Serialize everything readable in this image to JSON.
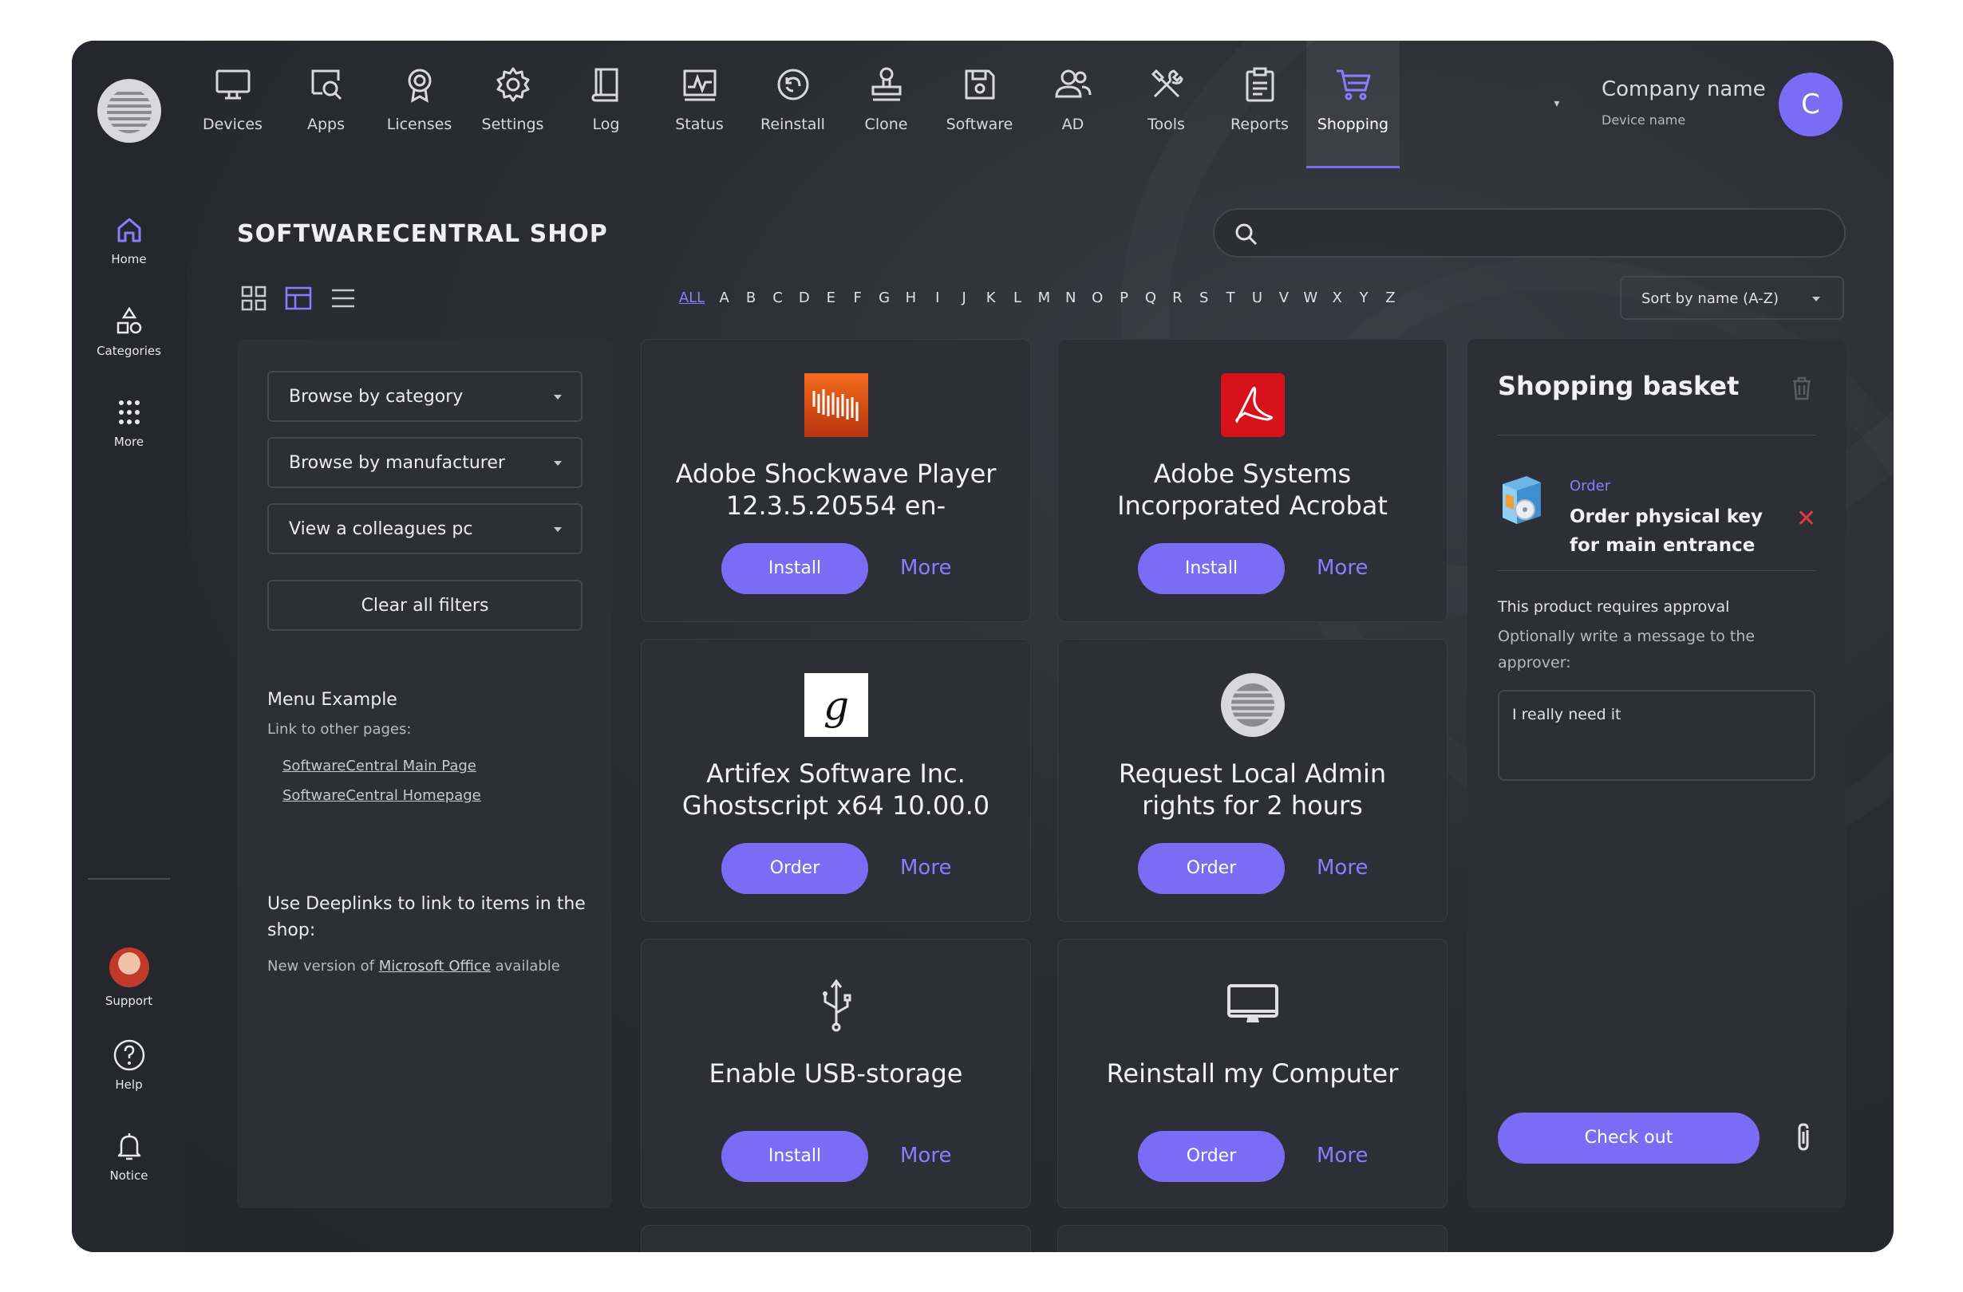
{
  "nav": [
    {
      "label": "Devices",
      "icon": "monitor-icon"
    },
    {
      "label": "Apps",
      "icon": "apps-search-icon"
    },
    {
      "label": "Licenses",
      "icon": "badge-icon"
    },
    {
      "label": "Settings",
      "icon": "gear-icon"
    },
    {
      "label": "Log",
      "icon": "book-icon"
    },
    {
      "label": "Status",
      "icon": "status-chart-icon"
    },
    {
      "label": "Reinstall",
      "icon": "reinstall-icon"
    },
    {
      "label": "Clone",
      "icon": "stamp-icon"
    },
    {
      "label": "Software",
      "icon": "floppy-icon"
    },
    {
      "label": "AD",
      "icon": "users-icon"
    },
    {
      "label": "Tools",
      "icon": "tools-icon"
    },
    {
      "label": "Reports",
      "icon": "clipboard-icon"
    },
    {
      "label": "Shopping",
      "icon": "cart-icon"
    }
  ],
  "active_nav": "Shopping",
  "account": {
    "company": "Company name",
    "device": "Device name",
    "initial": "C"
  },
  "rail": {
    "home": "Home",
    "categories": "Categories",
    "more": "More",
    "support": "Support",
    "help": "Help",
    "notice": "Notice"
  },
  "page_title": "SOFTWARECENTRAL SHOP",
  "search": {
    "placeholder": ""
  },
  "alphabet": {
    "all": "ALL",
    "letters": [
      "A",
      "B",
      "C",
      "D",
      "E",
      "F",
      "G",
      "H",
      "I",
      "J",
      "K",
      "L",
      "M",
      "N",
      "O",
      "P",
      "Q",
      "R",
      "S",
      "T",
      "U",
      "V",
      "W",
      "X",
      "Y",
      "Z"
    ]
  },
  "sort": {
    "label": "Sort by name (A-Z)"
  },
  "filters": {
    "category": "Browse by category",
    "manufacturer": "Browse by manufacturer",
    "colleague": "View a colleagues pc",
    "clear": "Clear all filters",
    "menu_title": "Menu Example",
    "menu_sub": "Link to other pages:",
    "link1": "SoftwareCentral Main Page",
    "link2": "SoftwareCentral Homepage",
    "deeplinks": "Use Deeplinks to link to items in the shop:",
    "deep_prefix": "New version of ",
    "deep_link": "Microsoft Office",
    "deep_suffix": " available"
  },
  "products": [
    {
      "line1": "Adobe Shockwave Player",
      "line2": "12.3.5.20554 en-",
      "action": "Install",
      "more": "More",
      "icon": "shockwave-icon"
    },
    {
      "line1": "Adobe Systems",
      "line2": "Incorporated Acrobat",
      "action": "Install",
      "more": "More",
      "icon": "acrobat-icon"
    },
    {
      "line1": "Artifex Software Inc.",
      "line2": "Ghostscript x64 10.00.0",
      "action": "Order",
      "more": "More",
      "icon": "ghostscript-icon"
    },
    {
      "line1": "Request Local Admin",
      "line2": "rights for 2 hours",
      "action": "Order",
      "more": "More",
      "icon": "softwarecentral-icon"
    },
    {
      "line1": "Enable USB-storage",
      "line2": "",
      "action": "Install",
      "more": "More",
      "icon": "usb-icon"
    },
    {
      "line1": "Reinstall my Computer",
      "line2": "",
      "action": "Order",
      "more": "More",
      "icon": "computer-icon"
    }
  ],
  "basket": {
    "title": "Shopping basket",
    "item_type": "Order",
    "item_name": "Order physical key for main entrance",
    "approval": "This product requires approval",
    "optional": "Optionally write a message to the approver:",
    "message": "I really need it",
    "checkout": "Check out"
  },
  "colors": {
    "accent": "#7b6cf6",
    "accent_text": "#8b7cff",
    "panel": "#2e2f36",
    "bg": "#2b2c33",
    "remove": "#e23b3b"
  }
}
